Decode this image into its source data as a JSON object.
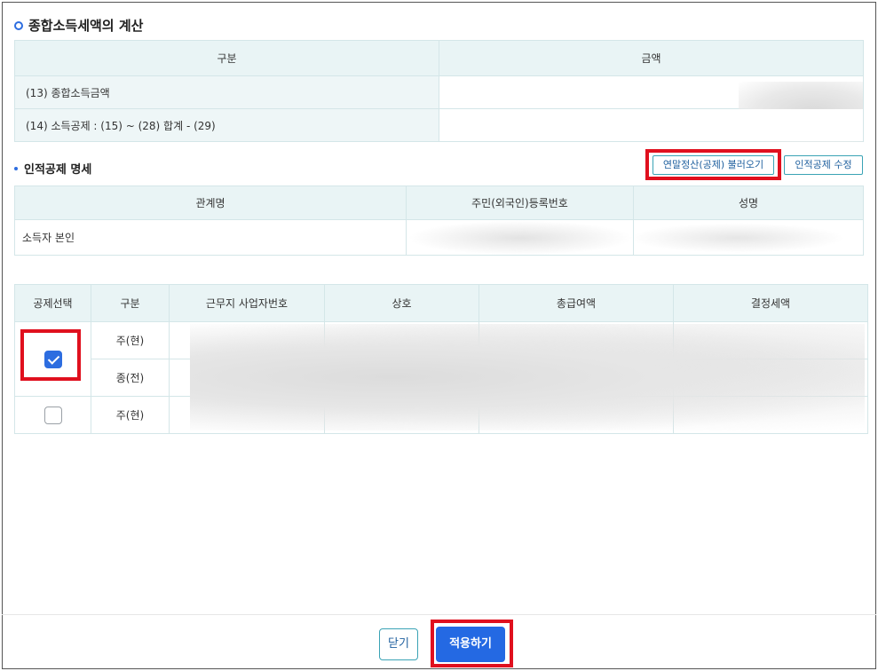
{
  "section_title": "종합소득세액의 계산",
  "calc_table": {
    "headers": [
      "구분",
      "금액"
    ],
    "rows": [
      {
        "label": "(13) 종합소득금액",
        "amount": ""
      },
      {
        "label": "(14) 소득공제 : (15) ~ (28) 합계 - (29)",
        "amount": ""
      }
    ]
  },
  "personal_section": {
    "title": "인적공제 명세",
    "load_button": "연말정산(공제) 불러오기",
    "edit_button": "인적공제 수정",
    "headers": [
      "관계명",
      "주민(외국인)등록번호",
      "성명"
    ],
    "rows": [
      {
        "relation": "소득자 본인",
        "id_number": "",
        "name": ""
      }
    ]
  },
  "work_table": {
    "headers": [
      "공제선택",
      "구분",
      "근무지 사업자번호",
      "상호",
      "총급여액",
      "결정세액"
    ],
    "rows": [
      {
        "type": "주(현)"
      },
      {
        "type": "종(전)"
      },
      {
        "type": "주(현)"
      }
    ],
    "group1_checked": true,
    "group2_checked": false
  },
  "footer": {
    "close_button": "닫기",
    "apply_button": "적용하기"
  },
  "colors": {
    "accent": "#2469e3",
    "highlight": "#e0101e",
    "header_bg": "#e9f4f5"
  }
}
